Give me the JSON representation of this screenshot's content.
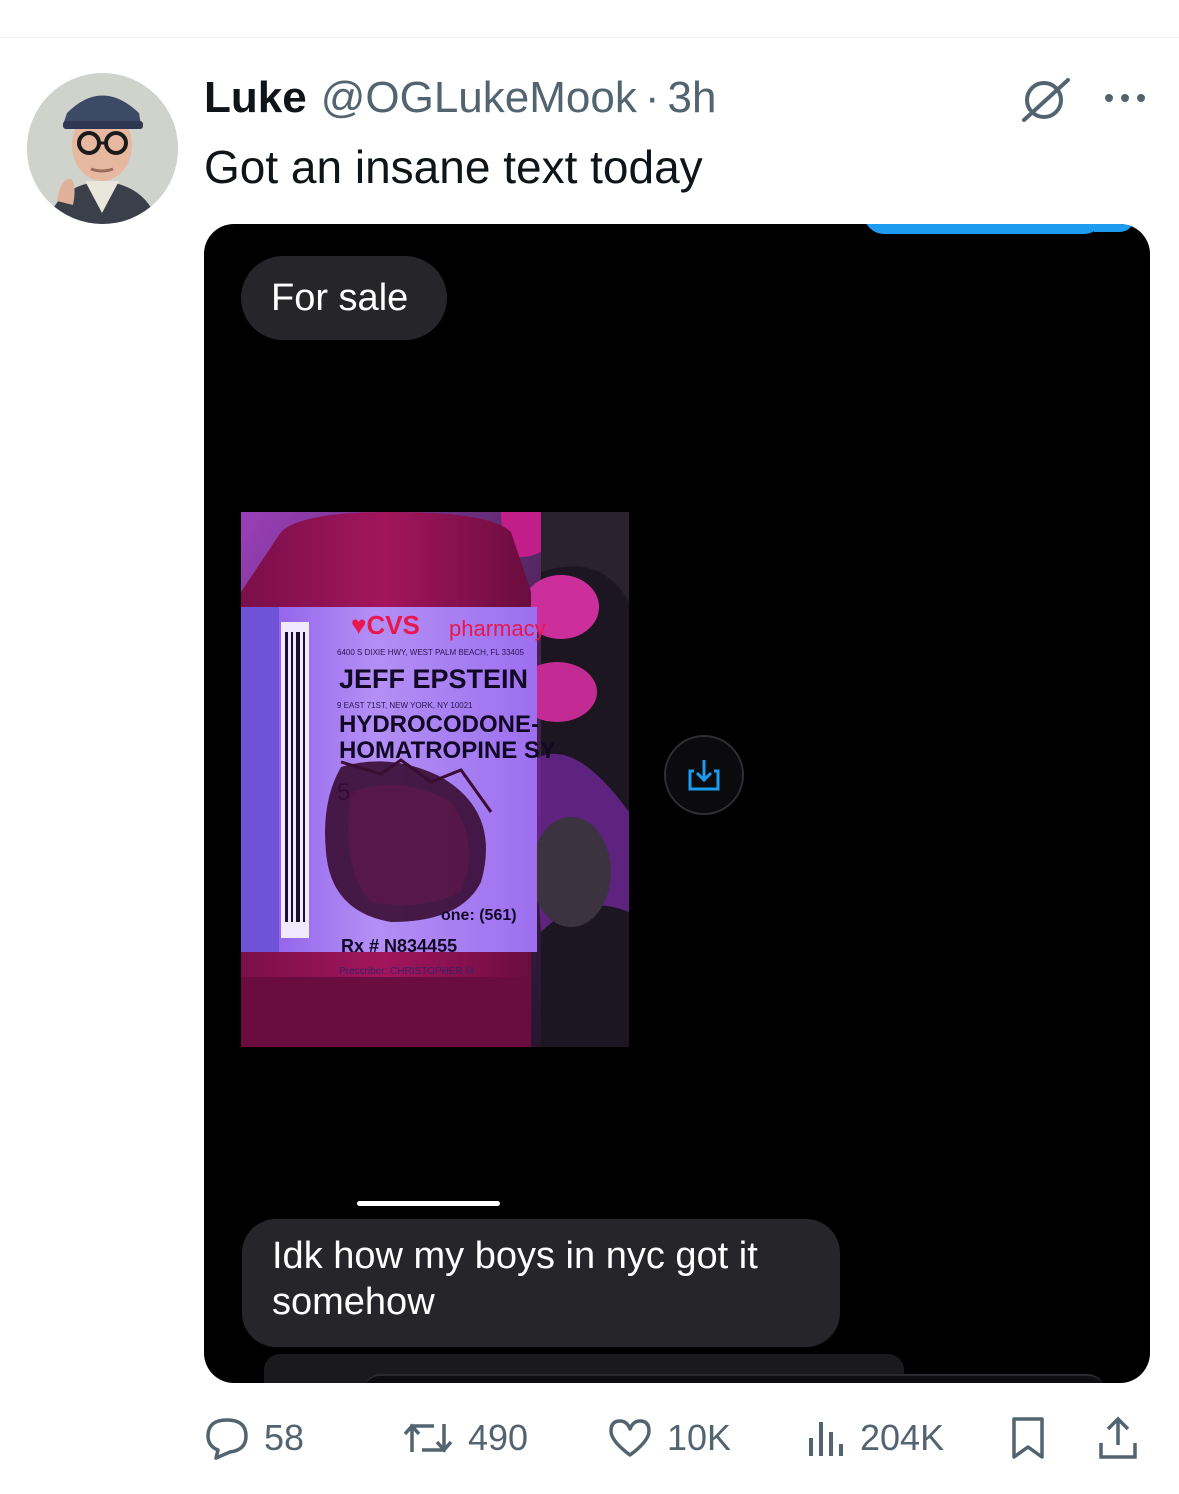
{
  "tweet": {
    "author_name": "Luke",
    "handle": "@OGLukeMook",
    "separator": "·",
    "time": "3h",
    "text": "Got an insane text today"
  },
  "media": {
    "messages": [
      {
        "text": "For sale",
        "from": "them"
      },
      {
        "text": "Idk how my boys in nyc got it somehow",
        "from": "them"
      }
    ],
    "photo_label": {
      "brand": "CVS",
      "brand_suffix": "pharmacy",
      "address": "6400 S DIXIE HWY, WEST PALM BEACH, FL 33405",
      "patient": "JEFF EPSTEIN",
      "patient_address": "9 EAST 71ST, NEW YORK, NY 10021",
      "drug_line1": "HYDROCODONE-",
      "drug_line2": "HOMATROPINE SY",
      "phone": "one: (561)",
      "rx": "Rx # N834455",
      "prescriber": "Prescriber: CHRISTOPHER M"
    }
  },
  "actions": {
    "replies": "58",
    "reposts": "490",
    "likes": "10K",
    "views": "204K"
  },
  "colors": {
    "text_primary": "#0f1419",
    "text_secondary": "#536471",
    "bubble_gray": "#26252a",
    "imessage_blue": "#1d9bf0"
  },
  "icons": [
    "grok-icon",
    "more-icon",
    "save-to-device-icon",
    "reply-icon",
    "repost-icon",
    "like-icon",
    "views-icon",
    "bookmark-icon",
    "share-icon"
  ]
}
